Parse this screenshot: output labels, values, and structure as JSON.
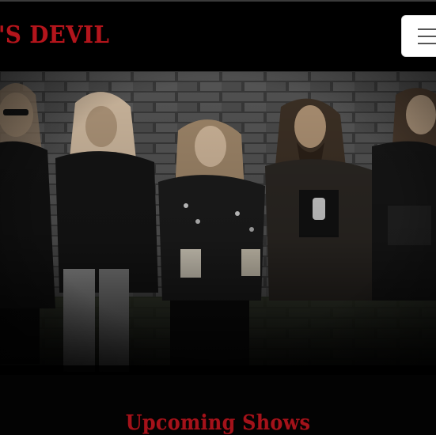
{
  "header": {
    "brand_text": "'S DEVIL",
    "menu_icon": "hamburger-menu-icon"
  },
  "hero": {
    "image_subject": "band-photo"
  },
  "sections": {
    "upcoming_title": "Upcoming Shows"
  },
  "colors": {
    "accent": "#b3151c",
    "background": "#000000",
    "menu_button": "#ffffff"
  }
}
